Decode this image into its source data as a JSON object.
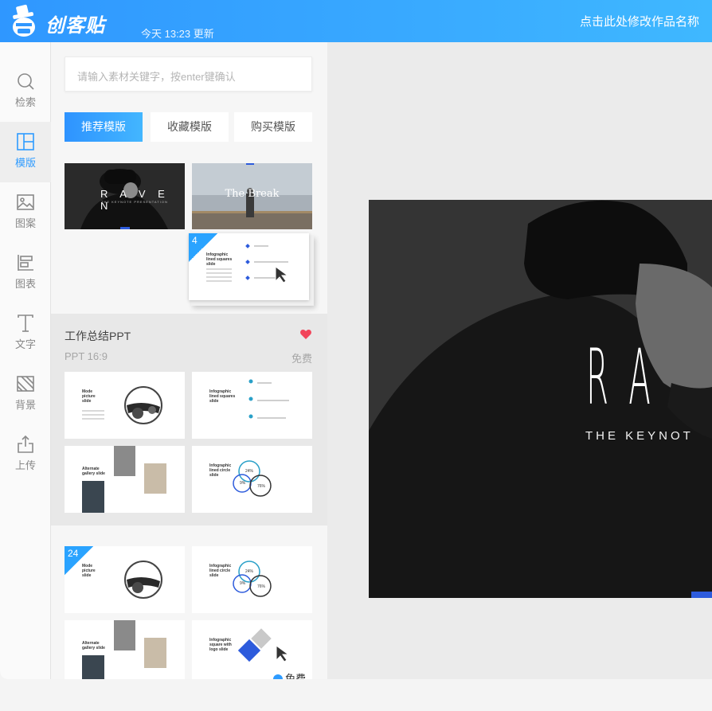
{
  "header": {
    "brand": "创客贴",
    "updated": "今天 13:23 更新",
    "rename_link": "点击此处修改作品名称",
    "accent": "#2e9bff"
  },
  "rail": [
    {
      "label": "检索",
      "icon": "search-icon"
    },
    {
      "label": "模版",
      "icon": "template-icon",
      "active": true
    },
    {
      "label": "图案",
      "icon": "image-icon"
    },
    {
      "label": "图表",
      "icon": "chart-icon"
    },
    {
      "label": "文字",
      "icon": "text-icon"
    },
    {
      "label": "背景",
      "icon": "background-icon"
    },
    {
      "label": "上传",
      "icon": "upload-icon"
    }
  ],
  "panel": {
    "search_placeholder": "请输入素材关键字，按enter键确认",
    "tabs": [
      "推荐模版",
      "收藏模版",
      "购买模版"
    ],
    "featured": [
      {
        "title": "R A V E N",
        "subtitle": "THE KEYNOTE PRESENTATION"
      },
      {
        "title": "The Break"
      }
    ],
    "drag_badge": "4",
    "group": {
      "title": "工作总结PPT",
      "ratio": "PPT 16:9",
      "price": "免费"
    },
    "bottom_badge": "24",
    "free_label": "免费"
  },
  "slides": {
    "mode_picture": "Mode picture slide",
    "infographic_squares": "Infographic lined squares slide",
    "alternate_gallery": "Alternate gallery slide",
    "infographic_circles": "Infographic lined circle slide",
    "infographic_square_logo": "Infographic square with logo slide",
    "pct_a": "24%",
    "pct_b": "9%",
    "pct_c": "76%"
  },
  "canvas": {
    "title": "RA",
    "subtitle": "THE KEYNOT"
  }
}
